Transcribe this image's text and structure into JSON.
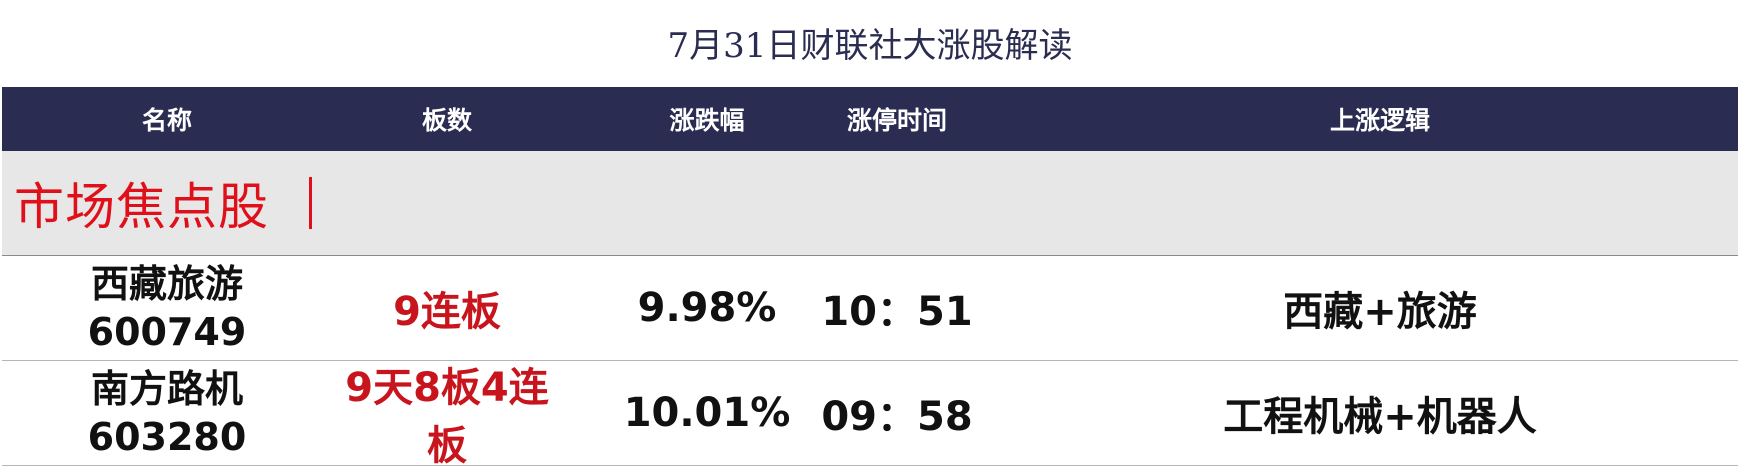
{
  "title": "7月31日财联社大涨股解读",
  "header": {
    "name": "名称",
    "boards": "板数",
    "change": "涨跌幅",
    "limit_time": "涨停时间",
    "logic": "上涨逻辑"
  },
  "section": {
    "label": "市场焦点股"
  },
  "rows": [
    {
      "name": "西藏旅游",
      "code": "600749",
      "boards": "9连板",
      "change": "9.98%",
      "limit_time": "10：51",
      "logic": "西藏+旅游"
    },
    {
      "name": "南方路机",
      "code": "603280",
      "boards": "9天8板4连板",
      "change": "10.01%",
      "limit_time": "09：58",
      "logic": "工程机械+机器人"
    }
  ],
  "colors": {
    "header_bg": "#2b2c52",
    "section_bg": "#e7e7e7",
    "accent_red": "#e0101a",
    "boards_red": "#c8141c"
  }
}
